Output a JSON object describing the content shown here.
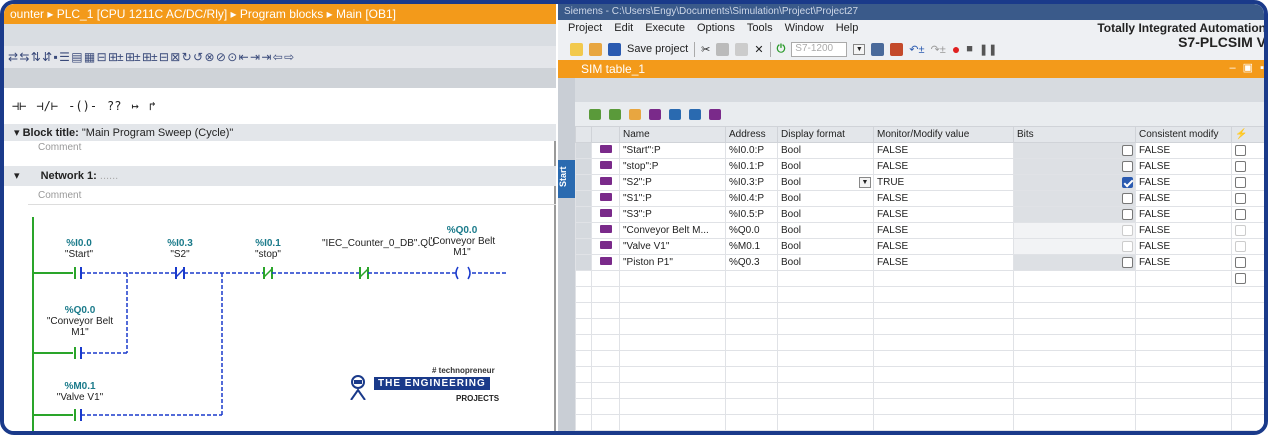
{
  "left": {
    "breadcrumb": "ounter ▸ PLC_1 [CPU 1211C AC/DC/Rly] ▸ Program blocks ▸ Main [OB1]",
    "toolbar_glyphs": "⇄ ⇆ ⇅ ⇵ ▪ ☰ ▤ ▦ ⊟ ⊞± ⊞± ⊞± ⊟ ⊠ ↻ ↺ ⊗ ⊘ ⊙ ⇤ ⇥ ⇥ ⇦ ⇨",
    "ladder_tools": [
      "⊣⊢",
      "⊣/⊢",
      "-()-",
      "??",
      "↦",
      "↱"
    ],
    "block_title_label": "Block title:",
    "block_title_value": "\"Main Program Sweep (Cycle)\"",
    "comment_1": "Comment",
    "network_label": "Network 1:",
    "network_value": "......",
    "comment_2": "Comment",
    "contacts": [
      {
        "addr": "%I0.0",
        "name": "\"Start\""
      },
      {
        "addr": "%I0.3",
        "name": "\"S2\""
      },
      {
        "addr": "%I0.1",
        "name": "\"stop\""
      },
      {
        "addr": "",
        "name": "\"IEC_Counter_0_DB\".QU"
      },
      {
        "addr": "%Q0.0",
        "name": "\"Conveyor Belt M1\""
      }
    ],
    "branch_1": {
      "addr": "%Q0.0",
      "name": "\"Conveyor Belt M1\""
    },
    "branch_2": {
      "addr": "%M0.1",
      "name": "\"Valve V1\""
    },
    "logo": {
      "tag": "# technopreneur",
      "main": "THE ENGINEERING",
      "sub": "PROJECTS"
    }
  },
  "right": {
    "window_title": "Siemens - C:\\Users\\Engy\\Documents\\Simulation\\Project\\Project27",
    "menu": [
      "Project",
      "Edit",
      "Execute",
      "Options",
      "Tools",
      "Window",
      "Help"
    ],
    "save_label": "Save project",
    "cpu_combo": "S7-1200",
    "brand_line1": "Totally Integrated Automation",
    "brand_line2": "S7-PLCSIM V",
    "side_tab": "Start",
    "sim_table_title": "SIM table_1",
    "columns": [
      "",
      "",
      "Name",
      "Address",
      "Display format",
      "Monitor/Modify value",
      "Bits",
      "Consistent modify",
      "⚡"
    ],
    "rows": [
      {
        "name": "\"Start\":P",
        "address": "%I0.0:P",
        "format": "Bool",
        "value": "FALSE",
        "bit": false,
        "consistent": "FALSE",
        "active": true
      },
      {
        "name": "\"stop\":P",
        "address": "%I0.1:P",
        "format": "Bool",
        "value": "FALSE",
        "bit": false,
        "consistent": "FALSE",
        "active": true
      },
      {
        "name": "\"S2\":P",
        "address": "%I0.3:P",
        "format": "Bool",
        "value": "TRUE",
        "bit": true,
        "consistent": "FALSE",
        "active": true
      },
      {
        "name": "\"S1\":P",
        "address": "%I0.4:P",
        "format": "Bool",
        "value": "FALSE",
        "bit": false,
        "consistent": "FALSE",
        "active": true
      },
      {
        "name": "\"S3\":P",
        "address": "%I0.5:P",
        "format": "Bool",
        "value": "FALSE",
        "bit": false,
        "consistent": "FALSE",
        "active": true
      },
      {
        "name": "\"Conveyor Belt M...",
        "address": "%Q0.0",
        "format": "Bool",
        "value": "FALSE",
        "bit": false,
        "consistent": "FALSE",
        "active": false
      },
      {
        "name": "\"Valve V1\"",
        "address": "%M0.1",
        "format": "Bool",
        "value": "FALSE",
        "bit": false,
        "consistent": "FALSE",
        "active": false
      },
      {
        "name": "\"Piston P1\"",
        "address": "%Q0.3",
        "format": "Bool",
        "value": "FALSE",
        "bit": false,
        "consistent": "FALSE",
        "active": true
      }
    ],
    "colors": {
      "orange": "#f39a1a",
      "blue": "#1a3a8a",
      "ladder": "#1a3acc",
      "tag_icon": "#7a2a8a"
    }
  }
}
